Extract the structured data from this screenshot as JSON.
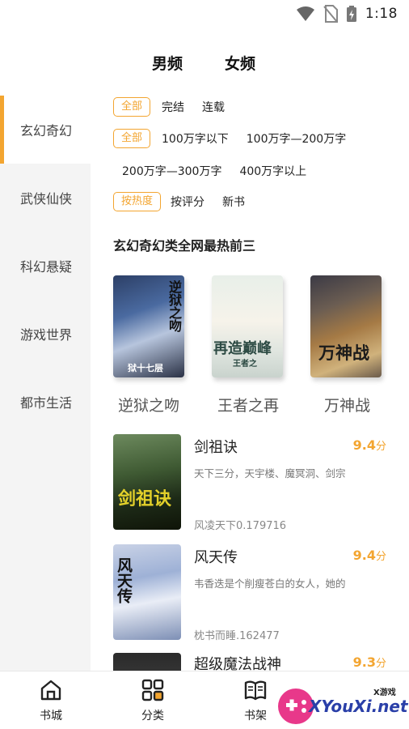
{
  "status_bar": {
    "time": "1:18",
    "icons": [
      "wifi-icon",
      "no-sim-icon",
      "battery-charging-icon"
    ]
  },
  "gender_tabs": [
    {
      "label": "男频",
      "active": true
    },
    {
      "label": "女频",
      "active": false
    }
  ],
  "sidebar": {
    "items": [
      {
        "label": "玄幻奇幻",
        "active": true
      },
      {
        "label": "武侠仙侠",
        "active": false
      },
      {
        "label": "科幻悬疑",
        "active": false
      },
      {
        "label": "游戏世界",
        "active": false
      },
      {
        "label": "都市生活",
        "active": false
      }
    ]
  },
  "filters": {
    "status": {
      "selected": "全部",
      "options": [
        "完结",
        "连载"
      ]
    },
    "length": {
      "selected": "全部",
      "options_row1": [
        "100万字以下",
        "100万字—200万字"
      ],
      "options_row2": [
        "200万字—300万字",
        "400万字以上"
      ]
    },
    "sort": {
      "selected": "按热度",
      "options": [
        "按评分",
        "新书"
      ]
    }
  },
  "top3": {
    "title": "玄幻奇幻类全网最热前三",
    "books": [
      {
        "title": "逆狱之吻",
        "cover_text": "逆狱之吻",
        "cover_sub": "狱十七层"
      },
      {
        "title": "王者之再",
        "cover_text": "再造巅峰",
        "cover_sub": "王者之"
      },
      {
        "title": "万神战",
        "cover_text": "万神战",
        "cover_sub": ""
      }
    ]
  },
  "books": [
    {
      "title": "剑祖诀",
      "score": "9.4",
      "score_unit": "分",
      "desc": "天下三分，天宇楼、魔冥洞、剑宗",
      "author": "风凌天下0.179716",
      "cover_text": "剑祖诀"
    },
    {
      "title": "风天传",
      "score": "9.4",
      "score_unit": "分",
      "desc": "韦香迭是个削瘦苍白的女人，她的",
      "author": "枕书而睡.162477",
      "cover_text": "风天传"
    },
    {
      "title": "超级魔法战神",
      "score": "9.3",
      "score_unit": "分"
    }
  ],
  "bottom_nav": [
    {
      "label": "书城",
      "icon": "home-icon"
    },
    {
      "label": "分类",
      "icon": "grid-icon"
    },
    {
      "label": "书架",
      "icon": "bookshelf-icon"
    }
  ],
  "watermark": {
    "text": "XYouXi.net",
    "small": "X游戏"
  },
  "colors": {
    "accent": "#f3a530",
    "sidebar_bg": "#f4f4f4",
    "watermark": "#2a3fa8"
  }
}
